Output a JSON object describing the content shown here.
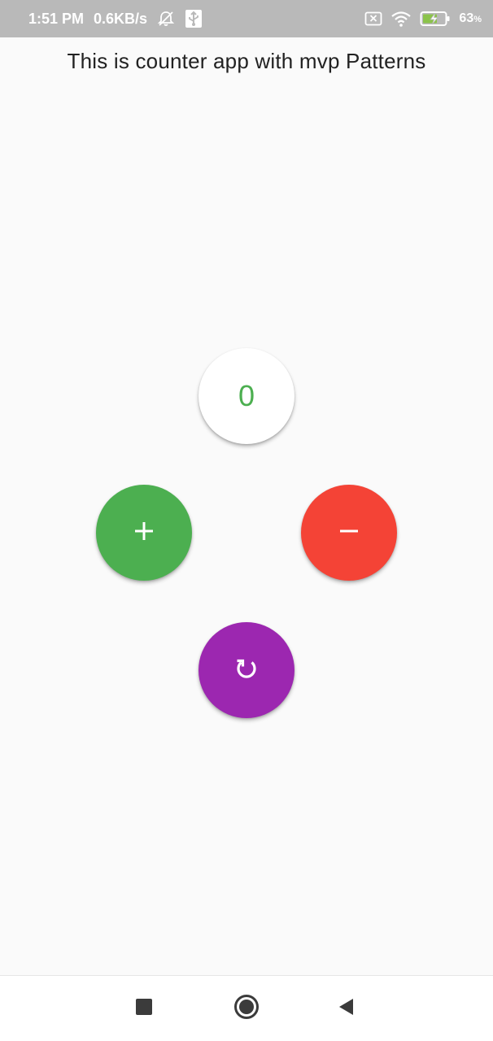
{
  "status_bar": {
    "time": "1:51 PM",
    "network_speed": "0.6KB/s",
    "battery_percent": "63",
    "battery_unit": "%",
    "icons": [
      "mute-alarm-icon",
      "usb-icon",
      "sim-x-icon",
      "wifi-icon",
      "battery-charging-icon"
    ]
  },
  "app": {
    "title": "This is counter app with mvp Patterns",
    "counter_value": "0",
    "buttons": {
      "increment_icon": "plus-icon",
      "decrement_icon": "minus-icon",
      "reset_icon": "refresh-icon"
    }
  },
  "colors": {
    "counter_text": "#4caf50",
    "increment": "#4caf50",
    "decrement": "#f44336",
    "reset": "#9c27b0",
    "status_bar": "#b9b9b9",
    "battery_fill": "#8bc34a"
  },
  "nav_bar": {
    "icons": [
      "recents-square-icon",
      "home-circle-icon",
      "back-triangle-icon"
    ]
  }
}
